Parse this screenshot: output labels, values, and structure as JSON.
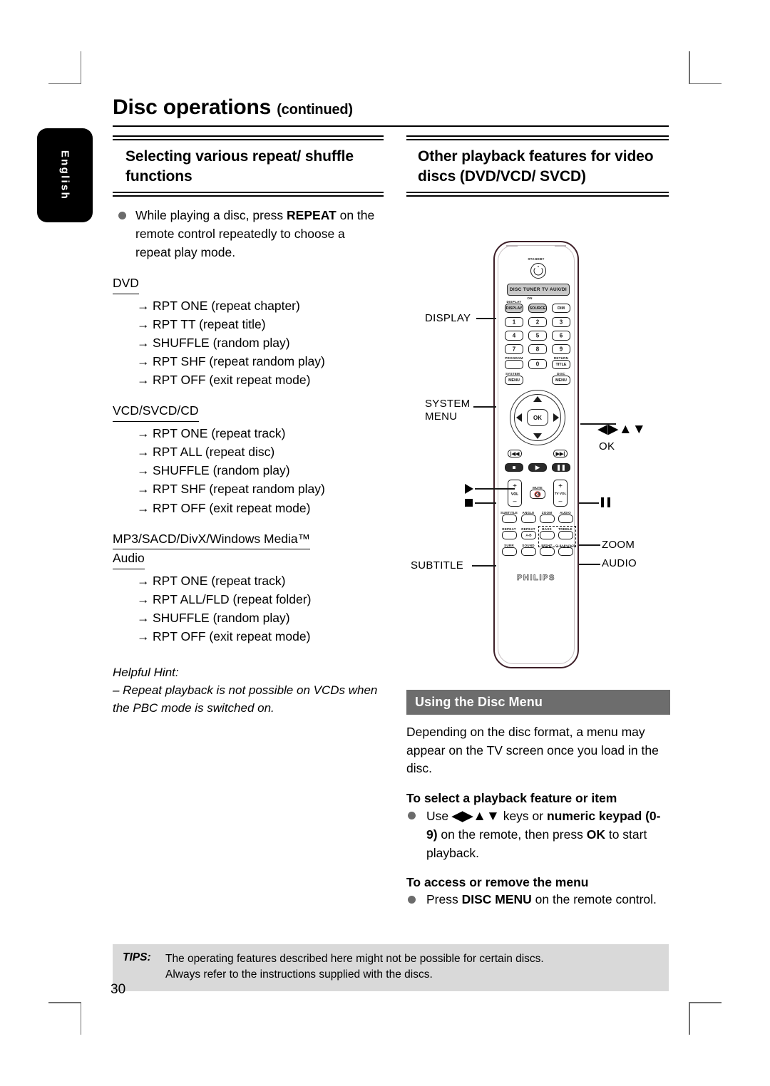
{
  "header": {
    "title": "Disc operations",
    "continued": "(continued)"
  },
  "language_tab": {
    "label": "English"
  },
  "left_column": {
    "section_title": "Selecting various repeat/ shuffle functions",
    "intro": {
      "text_1": "While playing a disc, press ",
      "bold_1": "REPEAT",
      "text_2": " on the remote control repeatedly to choose a repeat play mode."
    },
    "groups": [
      {
        "label": "DVD",
        "items": [
          "RPT ONE (repeat chapter)",
          "RPT  TT (repeat title)",
          "SHUFFLE (random play)",
          "RPT SHF (repeat random play)",
          "RPT OFF (exit repeat mode)"
        ]
      },
      {
        "label": "VCD/SVCD/CD",
        "items": [
          "RPT ONE (repeat track)",
          "RPT ALL (repeat disc)",
          "SHUFFLE (random play)",
          "RPT SHF (repeat random play)",
          "RPT OFF (exit repeat mode)"
        ]
      },
      {
        "label": "MP3/SACD/DivX/Windows Media™",
        "label_line2": "Audio",
        "items": [
          "RPT ONE (repeat track)",
          "RPT ALL/FLD (repeat folder)",
          "SHUFFLE (random play)",
          "RPT OFF (exit repeat mode)"
        ]
      }
    ],
    "hint": {
      "title": "Helpful Hint:",
      "body": "– Repeat playback is not possible on VCDs when the PBC mode is switched on."
    }
  },
  "right_column": {
    "section_title": "Other playback features for video discs (DVD/VCD/ SVCD)",
    "disc_menu_bar": "Using the Disc Menu",
    "disc_menu_para": "Depending on the disc format, a menu may appear on the TV screen once you load in the disc.",
    "subhead_1": "To select a playback feature or item",
    "bullet_1": {
      "t1": "Use ",
      "arrows": "◀▶▲▼",
      "t2": " keys or ",
      "b1": "numeric keypad",
      "b2": "(0-9)",
      "t3": " on the remote, then press ",
      "b3": "OK",
      "t4": " to start playback."
    },
    "subhead_2": "To access or remove the menu",
    "bullet_2": {
      "t1": "Press ",
      "b1": "DISC MENU",
      "t2": " on the remote control."
    }
  },
  "remote": {
    "standby_label": "STANDBY",
    "source_row": "DISC TUNER TV AUX/DI",
    "on_label": "ON",
    "buttons": {
      "display": "DISPLAY",
      "source": "SOURCE",
      "dim": "DIM",
      "num_1": "1",
      "num_2": "2",
      "num_3": "3",
      "num_4": "4",
      "num_5": "5",
      "num_6": "6",
      "num_7": "7",
      "num_8": "8",
      "num_9": "9",
      "num_0": "0",
      "program": "PROGRAM",
      "return": "RETURN",
      "title": "TITLE",
      "system": "SYSTEM",
      "disc": "DISC",
      "menu": "MENU",
      "ok": "OK",
      "vol": "VOL",
      "mute": "MUTE",
      "tv_vol": "TV VOL",
      "plus": "+",
      "minus": "–",
      "subtitle": "SUBTITLE",
      "angle": "ANGLE",
      "zoom": "ZOOM",
      "audio": "AUDIO",
      "repeat": "REPEAT",
      "repeat_ab": "REPEAT",
      "ab": "A-B",
      "bass": "BASS",
      "treble": "TREBLE",
      "surr": "SURR",
      "sound": "SOUND",
      "night": "NIGHT",
      "clearvoice": "CLEARVOICE"
    },
    "brand": "PHILIPS"
  },
  "callouts": {
    "display": "DISPLAY",
    "system_menu_line1": "SYSTEM",
    "system_menu_line2": "MENU",
    "nav_arrows": "◀▶▲▼",
    "ok": "OK",
    "subtitle": "SUBTITLE",
    "zoom": "ZOOM",
    "audio": "AUDIO"
  },
  "footer": {
    "tips_label": "TIPS:",
    "tips_line1": "The operating features described here might not be possible for certain discs.",
    "tips_line2": "Always refer to the instructions supplied with the discs.",
    "page_number": "30"
  }
}
